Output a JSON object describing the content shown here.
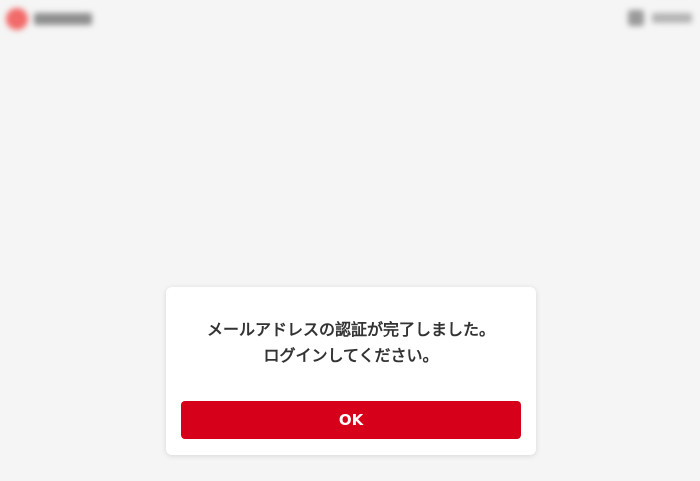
{
  "dialog": {
    "message": "メールアドレスの認証が完了しました。ログインしてください。",
    "ok_label": "OK"
  },
  "colors": {
    "background": "#f5f5f5",
    "button": "#d7001b",
    "text": "#333333"
  }
}
